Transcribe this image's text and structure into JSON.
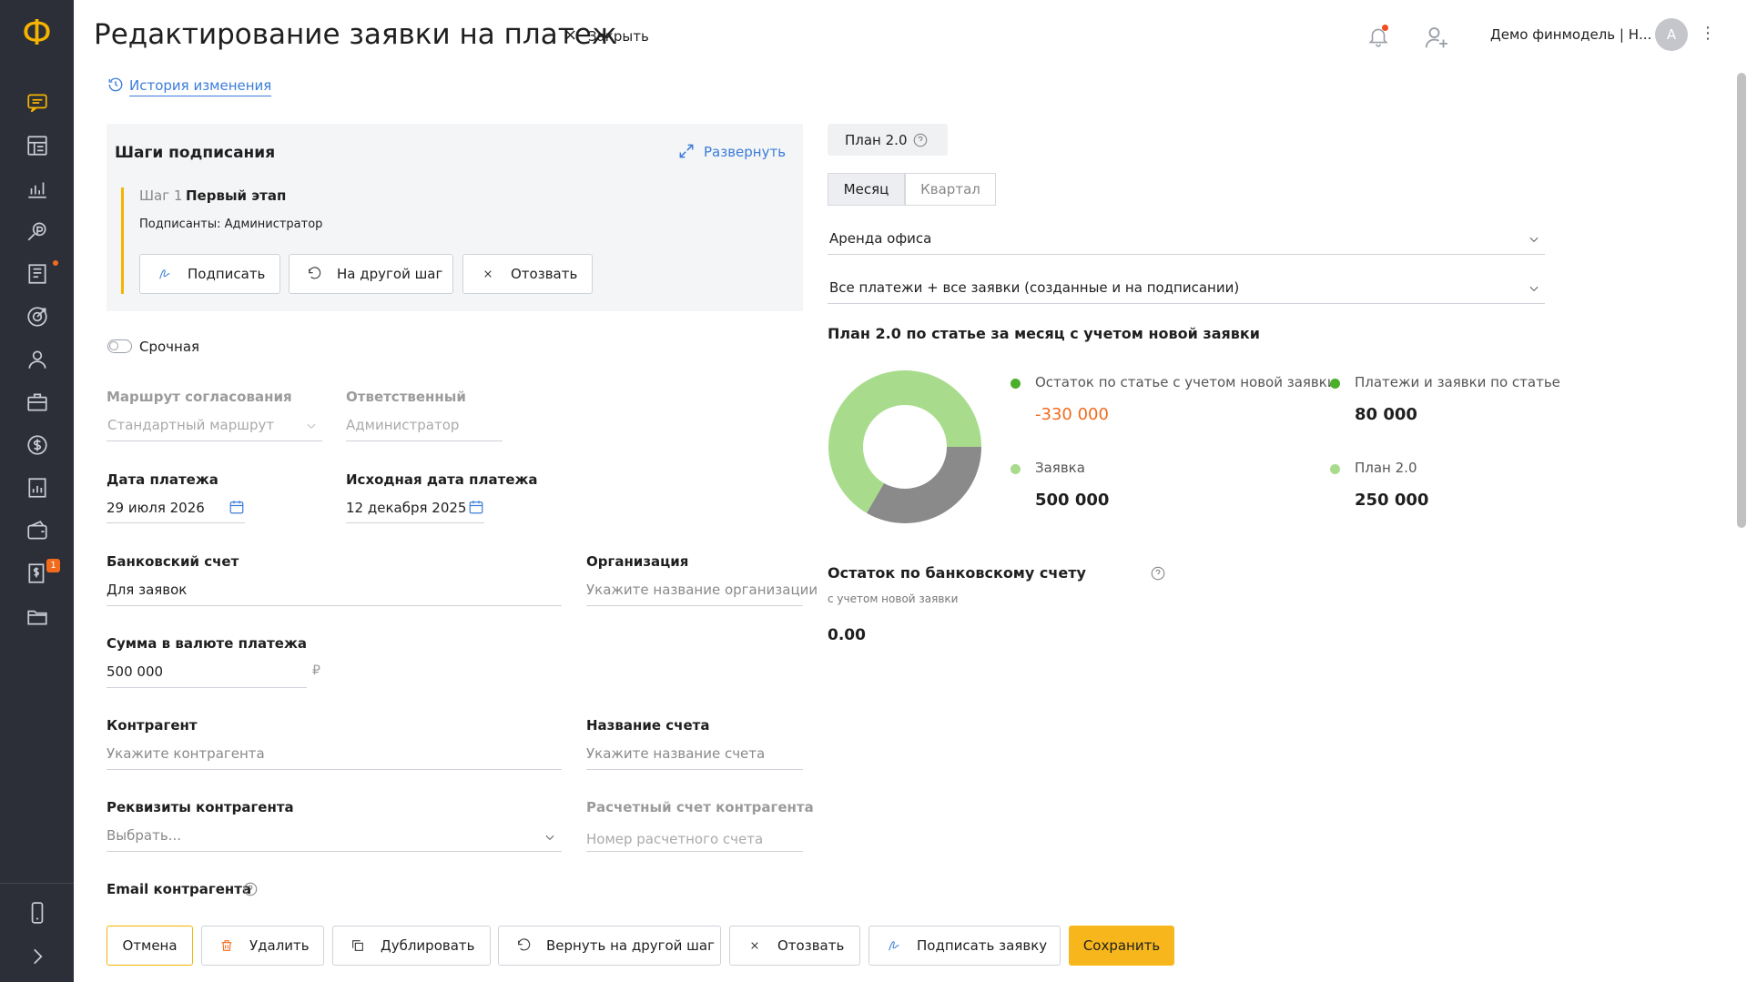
{
  "page": {
    "title": "Редактирование заявки на платеж",
    "close_label": "Закрыть",
    "history_link": "История изменения",
    "user_name": "Демо финмодель | Н...",
    "avatar_initial": "А"
  },
  "sidebar": {
    "logo": "Ф",
    "badge_count": "1",
    "items": [
      "messages",
      "dashboard",
      "analytics",
      "payments-search",
      "reports",
      "targets",
      "team",
      "portfolio",
      "finance",
      "documents",
      "wallet",
      "invoices",
      "folders"
    ]
  },
  "signing": {
    "title": "Шаги подписания",
    "expand_label": "Развернуть",
    "step_prefix": "Шаг 1",
    "step_name": "Первый этап",
    "signers": "Подписанты: Администратор",
    "btn_sign": "Подписать",
    "btn_other_step": "На другой шаг",
    "btn_revoke": "Отозвать"
  },
  "form": {
    "urgent_label": "Срочная",
    "route_label": "Маршрут согласования",
    "route_value": "Стандартный маршрут",
    "responsible_label": "Ответственный",
    "responsible_value": "Администратор",
    "pay_date_label": "Дата платежа",
    "pay_date_value": "29 июля 2026",
    "orig_date_label": "Исходная дата платежа",
    "orig_date_value": "12 декабря 2025",
    "bank_label": "Банковский счет",
    "bank_value": "Для заявок",
    "org_label": "Организация",
    "org_placeholder": "Укажите название организации",
    "amount_label": "Сумма в валюте платежа",
    "amount_value": "500 000",
    "currency": "₽",
    "contragent_label": "Контрагент",
    "contragent_placeholder": "Укажите контрагента",
    "account_name_label": "Название счета",
    "account_name_placeholder": "Укажите название счета",
    "requisites_label": "Реквизиты контрагента",
    "requisites_placeholder": "Выбрать...",
    "settlement_label": "Расчетный счет контрагента",
    "settlement_placeholder": "Номер расчетного счета",
    "email_label": "Email контрагента"
  },
  "footer": {
    "cancel": "Отмена",
    "delete": "Удалить",
    "duplicate": "Дублировать",
    "return_step": "Вернуть на другой шаг",
    "revoke": "Отозвать",
    "sign_request": "Подписать заявку",
    "save": "Сохранить"
  },
  "plan": {
    "badge": "План 2.0",
    "tab_month": "Месяц",
    "tab_quarter": "Квартал",
    "article": "Аренда офиса",
    "filter": "Все платежи + все заявки (созданные и на подписании)",
    "chart_title": "План 2.0 по статье за месяц с учетом новой заявки",
    "bank_rest_title": "Остаток по банковскому счету",
    "bank_rest_sub": "с учетом новой заявки",
    "bank_rest_value": "0.00"
  },
  "chart_data": {
    "type": "pie",
    "title": "План 2.0 по статье за месяц с учетом новой заявки",
    "legend": [
      {
        "name": "Остаток по статье с учетом новой заявки",
        "value": "-330 000",
        "color": "#4caf2a"
      },
      {
        "name": "Платежи и заявки по статье",
        "value": "80 000",
        "color": "#4caf2a"
      },
      {
        "name": "Заявка",
        "value": "500 000",
        "color": "#a8db8b"
      },
      {
        "name": "План 2.0",
        "value": "250 000",
        "color": "#a8db8b"
      }
    ],
    "slices": [
      {
        "value": 500000,
        "color": "#a8dc8c"
      },
      {
        "value": 250000,
        "color": "#8a8a8a"
      }
    ]
  }
}
